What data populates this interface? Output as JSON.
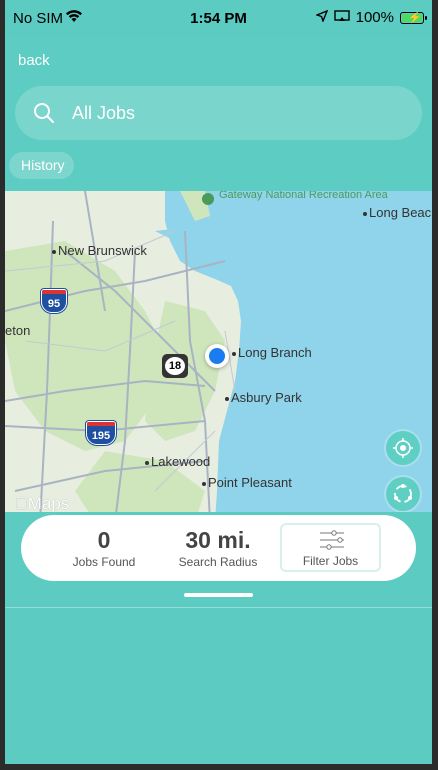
{
  "status_bar": {
    "carrier": "No SIM",
    "time": "1:54 PM",
    "battery": "100%"
  },
  "nav": {
    "back_label": "back"
  },
  "search": {
    "text": "All Jobs"
  },
  "history_label": "History",
  "map": {
    "places": {
      "gateway": "Gateway National Recreation Area",
      "long_beach": "Long Beac",
      "new_brunswick": "New Brunswick",
      "eton": "eton",
      "long_branch": "Long Branch",
      "asbury_park": "Asbury Park",
      "lakewood": "Lakewood",
      "point_pleasant": "Point Pleasant"
    },
    "shields": {
      "i95": "95",
      "i195": "195",
      "route18": "18"
    },
    "attribution": "Maps"
  },
  "summary": {
    "jobs_found_value": "0",
    "jobs_found_label": "Jobs Found",
    "radius_value": "30 mi.",
    "radius_label": "Search Radius",
    "filter_label": "Filter Jobs"
  },
  "colors": {
    "teal": "#5dccc2",
    "water": "#8fd4ea",
    "land": "#e7eee0",
    "park": "#c9e3b6",
    "location": "#1a7cf0"
  }
}
